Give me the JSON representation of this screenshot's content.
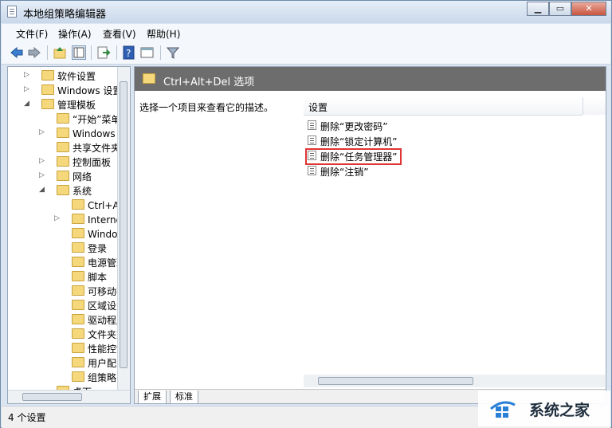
{
  "window": {
    "title": "本地组策略编辑器"
  },
  "menu": [
    "文件(F)",
    "操作(A)",
    "查看(V)",
    "帮助(H)"
  ],
  "tree": [
    {
      "label": "软件设置",
      "expander": "right"
    },
    {
      "label": "Windows 设置",
      "expander": "right"
    },
    {
      "label": "管理模板",
      "expander": "down"
    },
    {
      "label": "“开始”菜单",
      "expander": ""
    },
    {
      "label": "Windows 组件",
      "expander": "right"
    },
    {
      "label": "共享文件夹",
      "expander": ""
    },
    {
      "label": "控制面板",
      "expander": "right"
    },
    {
      "label": "网络",
      "expander": "right"
    },
    {
      "label": "系统",
      "expander": "down"
    },
    {
      "label": "Ctrl+Alt+Del 选项",
      "expander": ""
    },
    {
      "label": "Internet 通信管理",
      "expander": "right"
    },
    {
      "label": "Windows 文件保护",
      "expander": ""
    },
    {
      "label": "登录",
      "expander": ""
    },
    {
      "label": "电源管理",
      "expander": ""
    },
    {
      "label": "脚本",
      "expander": ""
    },
    {
      "label": "可移动存储访问",
      "expander": ""
    },
    {
      "label": "区域设置服务",
      "expander": ""
    },
    {
      "label": "驱动程序安装",
      "expander": ""
    },
    {
      "label": "文件夹重定向",
      "expander": ""
    },
    {
      "label": "性能控制面板",
      "expander": ""
    },
    {
      "label": "用户配置文件",
      "expander": ""
    },
    {
      "label": "组策略",
      "expander": ""
    },
    {
      "label": "桌面",
      "expander": ""
    }
  ],
  "right": {
    "header_title": "Ctrl+Alt+Del 选项",
    "description": "选择一个项目来查看它的描述。",
    "column_header": "设置",
    "policies": [
      "删除“更改密码”",
      "删除“锁定计算机”",
      "删除“任务管理器”",
      "删除“注销”"
    ],
    "tabs": [
      "扩展",
      "标准"
    ]
  },
  "status": {
    "text": "4 个设置"
  },
  "watermark": {
    "text": "系统之家"
  }
}
